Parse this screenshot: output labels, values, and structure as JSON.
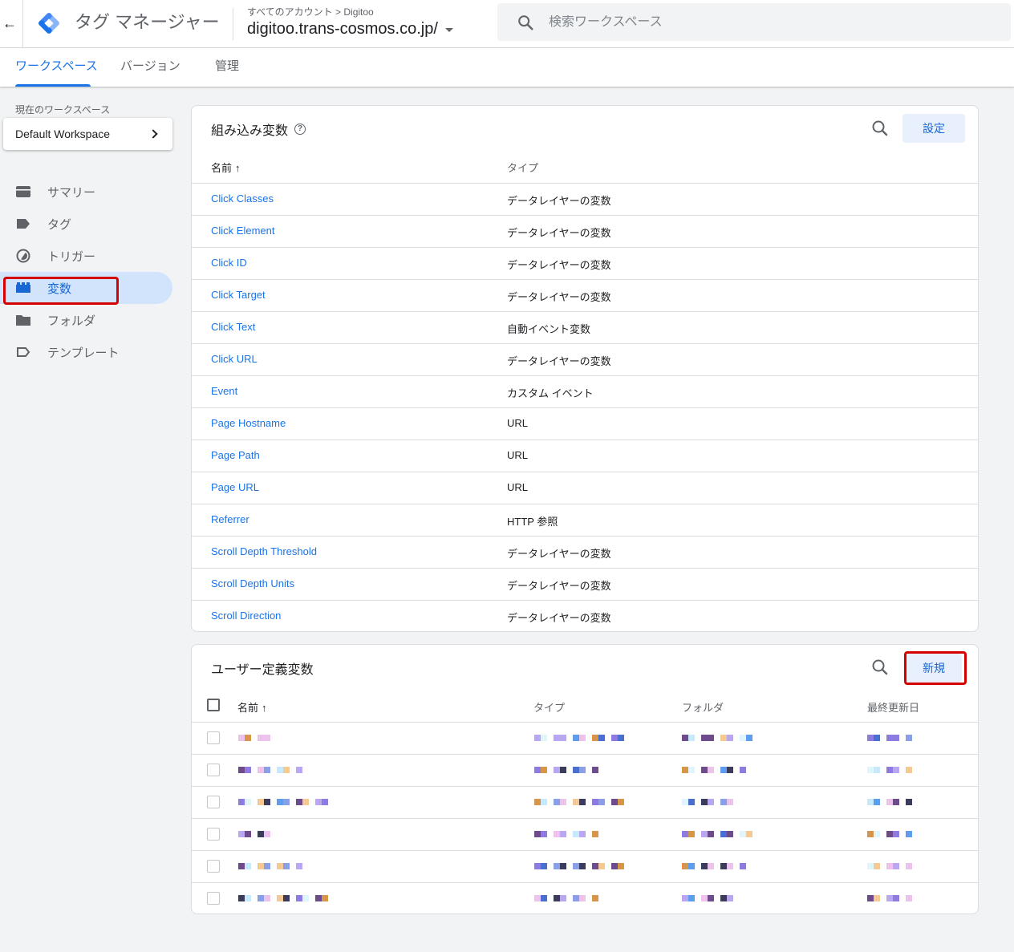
{
  "header": {
    "app_name": "タグ マネージャー",
    "breadcrumb": "すべてのアカウント > Digitoo",
    "container_name": "digitoo.trans-cosmos.co.jp/",
    "search_placeholder": "検索ワークスペース"
  },
  "tabs": [
    {
      "label": "ワークスペース",
      "active": true
    },
    {
      "label": "バージョン",
      "active": false
    },
    {
      "label": "管理",
      "active": false
    }
  ],
  "sidebar": {
    "workspace_label": "現在のワークスペース",
    "workspace_name": "Default Workspace",
    "items": [
      {
        "label": "サマリー",
        "icon": "summary-icon"
      },
      {
        "label": "タグ",
        "icon": "tag-icon"
      },
      {
        "label": "トリガー",
        "icon": "trigger-icon"
      },
      {
        "label": "変数",
        "icon": "variables-icon",
        "active": true,
        "highlighted": true
      },
      {
        "label": "フォルダ",
        "icon": "folder-icon"
      },
      {
        "label": "テンプレート",
        "icon": "template-icon"
      }
    ]
  },
  "builtin": {
    "title": "組み込み変数",
    "configure_label": "設定",
    "col_name": "名前",
    "col_type": "タイプ",
    "rows": [
      {
        "name": "Click Classes",
        "type": "データレイヤーの変数"
      },
      {
        "name": "Click Element",
        "type": "データレイヤーの変数"
      },
      {
        "name": "Click ID",
        "type": "データレイヤーの変数"
      },
      {
        "name": "Click Target",
        "type": "データレイヤーの変数"
      },
      {
        "name": "Click Text",
        "type": "自動イベント変数"
      },
      {
        "name": "Click URL",
        "type": "データレイヤーの変数"
      },
      {
        "name": "Event",
        "type": "カスタム イベント"
      },
      {
        "name": "Page Hostname",
        "type": "URL"
      },
      {
        "name": "Page Path",
        "type": "URL"
      },
      {
        "name": "Page URL",
        "type": "URL"
      },
      {
        "name": "Referrer",
        "type": "HTTP 参照"
      },
      {
        "name": "Scroll Depth Threshold",
        "type": "データレイヤーの変数"
      },
      {
        "name": "Scroll Depth Units",
        "type": "データレイヤーの変数"
      },
      {
        "name": "Scroll Direction",
        "type": "データレイヤーの変数"
      }
    ]
  },
  "user_defined": {
    "title": "ユーザー定義変数",
    "new_label": "新規",
    "col_name": "名前",
    "col_type": "タイプ",
    "col_folder": "フォルダ",
    "col_updated": "最終更新日",
    "row_count": 6
  },
  "colors": {
    "accent": "#1a73e8",
    "highlight": "#d50000",
    "active_nav_bg": "#d2e3fc"
  }
}
